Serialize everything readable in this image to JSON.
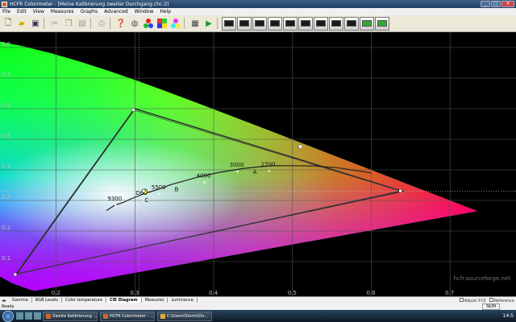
{
  "window": {
    "title": "HCFR Colorimeter - [Meine Kalibrierung zweiter Durchgang.chc:2]",
    "minimize_icon": "minimize-icon",
    "maximize_icon": "maximize-icon",
    "close_icon": "close-icon"
  },
  "menu": [
    "File",
    "Edit",
    "View",
    "Measures",
    "Graphs",
    "Advanced",
    "Window",
    "Help"
  ],
  "toolbar_icons": [
    "new-file-icon",
    "open-folder-icon",
    "save-icon",
    "cut-icon",
    "copy-icon",
    "paste-icon",
    "print-icon",
    "help-icon",
    "color-sensor-icon",
    "rgb-primaries-icon",
    "color-palette-icon",
    "rgb-secondaries-icon",
    "camera-icon",
    "play-icon",
    "monitor-icon",
    "monitor-icon",
    "monitor-icon",
    "monitor-icon",
    "monitor-icon",
    "monitor-icon",
    "monitor-icon",
    "monitor-icon",
    "monitor-icon",
    "monitor-icon",
    "monitor-icon"
  ],
  "tabs": {
    "items": [
      "Gamma",
      "RGB Levels",
      "Color temperature",
      "CIE Diagram",
      "Measures",
      "Luminance"
    ],
    "active": "CIE Diagram",
    "adjust_label": "Adjust XYZ",
    "reference_label": "Reference"
  },
  "status": {
    "ready": "Ready",
    "num": "NUM"
  },
  "taskbar": {
    "tasks": [
      "Zweite Kalibrierung ...",
      "HCFR Colorimeter - ...",
      "C:\\Users\\Storm\\Do..."
    ],
    "clock": "14:5"
  },
  "chart_data": {
    "type": "scatter",
    "title": "",
    "xlabel": "",
    "ylabel": "",
    "xlim": [
      0.1,
      0.75
    ],
    "ylim": [
      0.0,
      0.85
    ],
    "x_ticks": [
      "0.1",
      "0.2",
      "0.3",
      "0.4",
      "0.5",
      "0.6",
      "0.7"
    ],
    "y_ticks": [
      "0.1",
      "0.2",
      "0.3",
      "0.4",
      "0.5",
      "0.6",
      "0.7",
      "0.8"
    ],
    "grid": true,
    "watermark": "hcfr.sourceforge.net",
    "spectral_locus": [
      [
        0.1741,
        0.005
      ],
      [
        0.1733,
        0.0048
      ],
      [
        0.1726,
        0.0048
      ],
      [
        0.1714,
        0.0051
      ],
      [
        0.1689,
        0.0069
      ],
      [
        0.1644,
        0.0109
      ],
      [
        0.1566,
        0.0177
      ],
      [
        0.144,
        0.0297
      ],
      [
        0.1241,
        0.0578
      ],
      [
        0.0913,
        0.1327
      ],
      [
        0.0687,
        0.2007
      ],
      [
        0.0454,
        0.295
      ],
      [
        0.0235,
        0.4127
      ],
      [
        0.0082,
        0.5384
      ],
      [
        0.0139,
        0.7502
      ],
      [
        0.0389,
        0.812
      ],
      [
        0.0743,
        0.8338
      ],
      [
        0.1142,
        0.8262
      ],
      [
        0.1547,
        0.8059
      ],
      [
        0.1929,
        0.7816
      ],
      [
        0.2296,
        0.7543
      ],
      [
        0.2658,
        0.7243
      ],
      [
        0.3016,
        0.6923
      ],
      [
        0.3373,
        0.6589
      ],
      [
        0.3731,
        0.6245
      ],
      [
        0.4087,
        0.5896
      ],
      [
        0.4441,
        0.5547
      ],
      [
        0.4788,
        0.5202
      ],
      [
        0.5125,
        0.4866
      ],
      [
        0.5448,
        0.4544
      ],
      [
        0.5752,
        0.4242
      ],
      [
        0.6029,
        0.3965
      ],
      [
        0.627,
        0.3725
      ],
      [
        0.6482,
        0.3514
      ],
      [
        0.6658,
        0.334
      ],
      [
        0.6801,
        0.3197
      ],
      [
        0.6915,
        0.3083
      ],
      [
        0.7006,
        0.2993
      ],
      [
        0.7079,
        0.292
      ],
      [
        0.714,
        0.2859
      ],
      [
        0.719,
        0.2809
      ],
      [
        0.723,
        0.277
      ],
      [
        0.726,
        0.274
      ],
      [
        0.7283,
        0.2717
      ],
      [
        0.73,
        0.27
      ],
      [
        0.7311,
        0.2689
      ],
      [
        0.732,
        0.268
      ],
      [
        0.7327,
        0.2673
      ],
      [
        0.7334,
        0.2666
      ],
      [
        0.734,
        0.266
      ],
      [
        0.7344,
        0.2656
      ],
      [
        0.7347,
        0.2653
      ]
    ],
    "gamut_reference": [
      [
        0.64,
        0.33
      ],
      [
        0.3,
        0.6
      ],
      [
        0.15,
        0.06
      ]
    ],
    "gamut_measured": [
      [
        0.637,
        0.331
      ],
      [
        0.298,
        0.596
      ],
      [
        0.148,
        0.058
      ]
    ],
    "white_point": [
      0.3127,
      0.329
    ],
    "measured_white": [
      0.311,
      0.331
    ],
    "planckian_locus": [
      [
        0.264,
        0.267
      ],
      [
        0.274,
        0.284
      ],
      [
        0.2852,
        0.2933
      ],
      [
        0.2951,
        0.3052
      ],
      [
        0.3135,
        0.3236
      ],
      [
        0.3325,
        0.3387
      ],
      [
        0.3452,
        0.3516
      ],
      [
        0.3805,
        0.3768
      ],
      [
        0.4052,
        0.3907
      ],
      [
        0.4369,
        0.4041
      ],
      [
        0.4599,
        0.4106
      ],
      [
        0.4763,
        0.4137
      ],
      [
        0.527,
        0.413
      ],
      [
        0.56,
        0.406
      ],
      [
        0.6,
        0.39
      ]
    ],
    "cct_labels": [
      {
        "label": "9300",
        "x": 0.2652,
        "y": 0.3
      },
      {
        "label": "D65",
        "x": 0.3012,
        "y": 0.318
      },
      {
        "label": "5500",
        "x": 0.321,
        "y": 0.337
      },
      {
        "label": "4000",
        "x": 0.378,
        "y": 0.375
      },
      {
        "label": "3000",
        "x": 0.42,
        "y": 0.41
      },
      {
        "label": "2700",
        "x": 0.46,
        "y": 0.412
      }
    ],
    "illuminant_labels": [
      {
        "label": "C",
        "x": 0.3101,
        "y": 0.3162
      },
      {
        "label": "B",
        "x": 0.3484,
        "y": 0.3516
      },
      {
        "label": "A",
        "x": 0.4476,
        "y": 0.4074
      }
    ],
    "extra_points": [
      {
        "x": 0.51,
        "y": 0.476
      }
    ],
    "crosshair": [
      0.305,
      0.33
    ]
  }
}
